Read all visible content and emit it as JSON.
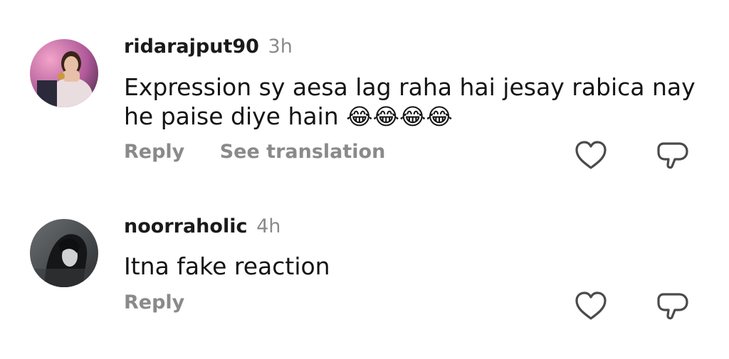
{
  "comments": [
    {
      "username": "ridarajput90",
      "time": "3h",
      "text_line1": "Expression sy aesa lag raha hai jesay rabica nay",
      "text_line2": "he paise diye hain",
      "emojis": "😂😂😂😂",
      "reply_label": "Reply",
      "translate_label": "See translation",
      "like_icon": "heart-outline-icon",
      "dislike_icon": "thumbs-down-bubble-icon"
    },
    {
      "username": "noorraholic",
      "time": "4h",
      "text_line1": "Itna fake reaction",
      "reply_label": "Reply",
      "like_icon": "heart-outline-icon",
      "dislike_icon": "thumbs-down-bubble-icon"
    }
  ],
  "colors": {
    "text": "#141414",
    "muted": "#8a8a8a",
    "background": "#ffffff"
  }
}
